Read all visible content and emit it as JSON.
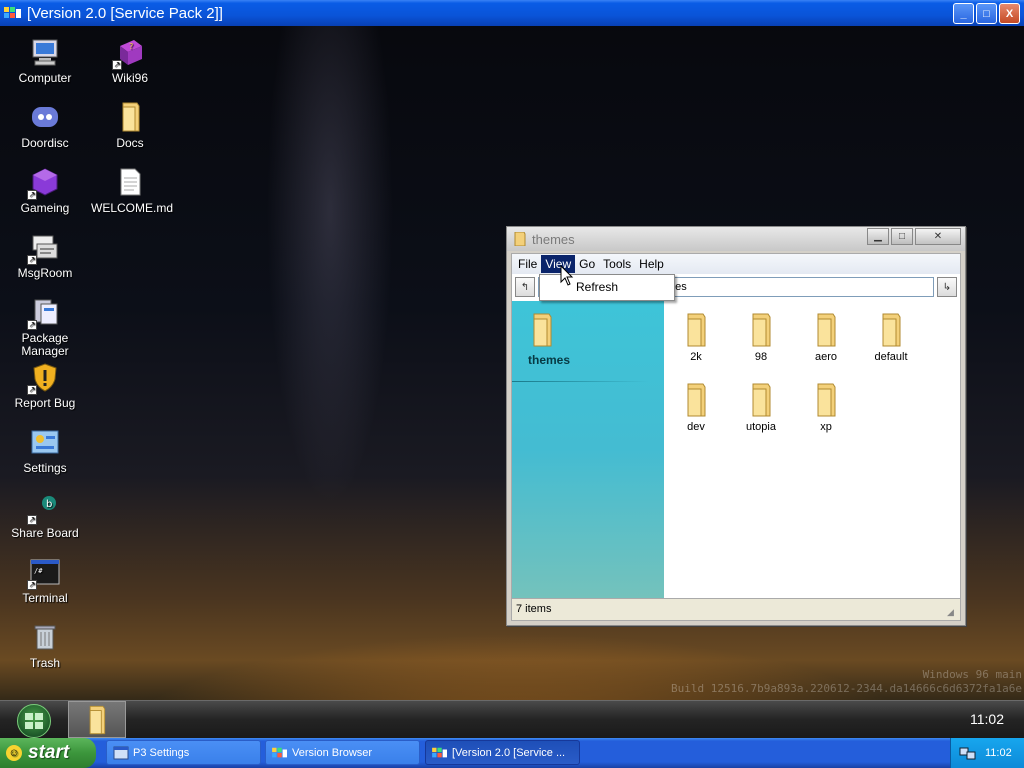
{
  "outer_window": {
    "title": "[Version 2.0 [Service Pack 2]]",
    "min": "_",
    "max": "□",
    "close": "X"
  },
  "desktop_icons": [
    {
      "label": "Computer",
      "icon": "computer-icon"
    },
    {
      "label": "Doordisc",
      "icon": "discord-icon"
    },
    {
      "label": "Gameing",
      "icon": "cube-icon"
    },
    {
      "label": "MsgRoom",
      "icon": "chat-icon"
    },
    {
      "label": "Package Manager",
      "icon": "package-icon"
    },
    {
      "label": "Report Bug",
      "icon": "warning-shield-icon"
    },
    {
      "label": "Settings",
      "icon": "settings-icon"
    },
    {
      "label": "Share Board",
      "icon": "share-board-icon"
    },
    {
      "label": "Terminal",
      "icon": "terminal-icon"
    },
    {
      "label": "Trash",
      "icon": "trash-icon"
    },
    {
      "label": "Wiki96",
      "icon": "book-icon"
    },
    {
      "label": "Docs",
      "icon": "folder-icon"
    },
    {
      "label": "WELCOME.md",
      "icon": "document-icon"
    }
  ],
  "explorer": {
    "title": "themes",
    "menu": [
      "File",
      "View",
      "Go",
      "Tools",
      "Help"
    ],
    "active_menu": "View",
    "dropdown_items": [
      "Refresh"
    ],
    "address": "nes",
    "back": "↰",
    "go": "↳",
    "sidebar_title": "themes",
    "files": [
      "2k",
      "98",
      "aero",
      "default",
      "dev",
      "utopia",
      "xp"
    ],
    "status": "7 items"
  },
  "watermark": {
    "line1": "Windows 96 main",
    "line2": "Build 12516.7b9a893a.220612-2344.da14666c6d6372fa1a6e"
  },
  "dock": {
    "clock": "11:02"
  },
  "taskbar": {
    "start_label": "start",
    "tasks": [
      "P3 Settings",
      "Version Browser",
      "[Version 2.0 [Service ..."
    ],
    "clock": "11:02"
  },
  "colors": {
    "titlebar": "#0a54d8",
    "taskbar": "#245edb",
    "start": "#3c963c",
    "sidebar": "#3ec4d8"
  }
}
